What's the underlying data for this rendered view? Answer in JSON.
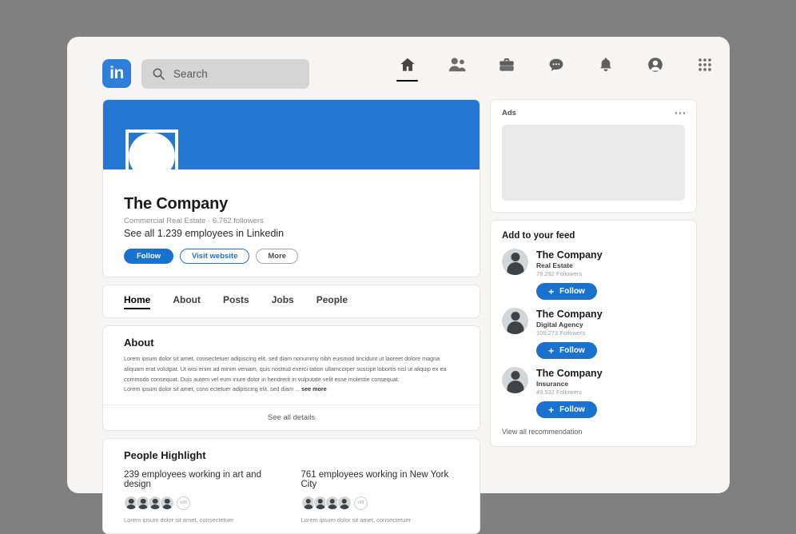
{
  "topbar": {
    "logo_text": "in",
    "search_placeholder": "Search",
    "nav_items": [
      {
        "name": "home",
        "icon": "home-icon",
        "active": true
      },
      {
        "name": "network",
        "icon": "people-icon",
        "active": false
      },
      {
        "name": "jobs",
        "icon": "briefcase-icon",
        "active": false
      },
      {
        "name": "messaging",
        "icon": "message-bubble-icon",
        "active": false
      },
      {
        "name": "notifications",
        "icon": "bell-icon",
        "active": false
      },
      {
        "name": "me",
        "icon": "profile-avatar-icon",
        "active": false
      },
      {
        "name": "apps",
        "icon": "grid-apps-icon",
        "active": false
      }
    ]
  },
  "profile": {
    "name": "The Company",
    "meta": "Commercial Real Estate · 6.762 followers",
    "employees_link": "See all 1.239 employees in Linkedin",
    "buttons": {
      "follow": "Follow",
      "visit_website": "Visit website",
      "more": "More"
    }
  },
  "tabs": [
    {
      "label": "Home",
      "active": true
    },
    {
      "label": "About",
      "active": false
    },
    {
      "label": "Posts",
      "active": false
    },
    {
      "label": "Jobs",
      "active": false
    },
    {
      "label": "People",
      "active": false
    }
  ],
  "about": {
    "title": "About",
    "paragraph1": "Lorem ipsum dolor sit amet, consectetuer adipiscing elit, sed diam nonummy nibh euismod tincidunt ut laoreet dolore magna aliquam erat volutpat. Ut wisi enim ad minim veniam, quis nostrud exerci tation ullamcorper suscipit lobortis nisl ut aliquip ex ea commodo consequat. Duis autem vel eum iriure dolor in hendrerit in vulputate velit esse molestie consequat.",
    "paragraph2": "Lorem ipsum dolor sit amet, cons ectetuer adipiscing elit, sed diam ... ",
    "see_more": "see more",
    "see_all_details": "See all details"
  },
  "people_highlight": {
    "title": "People Highlight",
    "columns": [
      {
        "label": "239 employees working in art and design",
        "overflow": "+99",
        "caption": "Lorem ipsum dolor sit amet, consectetuer"
      },
      {
        "label": "761 employees working in New York City",
        "overflow": "+99",
        "caption": "Lorem ipsum dolor sit amet, consectetuer"
      }
    ]
  },
  "sidebar": {
    "ads": {
      "title": "Ads"
    },
    "feed": {
      "title": "Add to your feed",
      "items": [
        {
          "name": "The Company",
          "category": "Real Estate",
          "followers": "78.292 Followers",
          "follow_label": "Follow"
        },
        {
          "name": "The Company",
          "category": "Digital Agency",
          "followers": "108.273 Followers",
          "follow_label": "Follow"
        },
        {
          "name": "The Company",
          "category": "Insurance",
          "followers": "49.532 Followers",
          "follow_label": "Follow"
        }
      ],
      "view_all": "View all recommendation"
    }
  },
  "colors": {
    "brand_blue": "#2478d4",
    "button_blue": "#1a72cf",
    "logo_blue": "#2d7fd9",
    "page_background": "#808080",
    "window_background": "#f6f5f3"
  }
}
